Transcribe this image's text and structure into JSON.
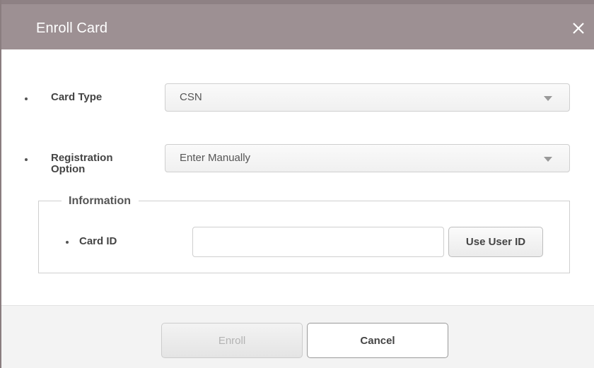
{
  "dialog": {
    "title": "Enroll Card",
    "close_icon": "close-icon"
  },
  "form": {
    "card_type": {
      "label": "Card Type",
      "value": "CSN"
    },
    "registration_option": {
      "label_line1": "Registration",
      "label_line2": "Option",
      "value": "Enter Manually"
    },
    "information": {
      "legend": "Information",
      "card_id": {
        "label": "Card ID",
        "value": ""
      },
      "use_user_id_label": "Use User ID"
    }
  },
  "footer": {
    "enroll_label": "Enroll",
    "cancel_label": "Cancel"
  },
  "colors": {
    "titlebar": "#9d9093",
    "footer_bg": "#f3f3f3",
    "disabled_text": "#b3b3b3"
  }
}
